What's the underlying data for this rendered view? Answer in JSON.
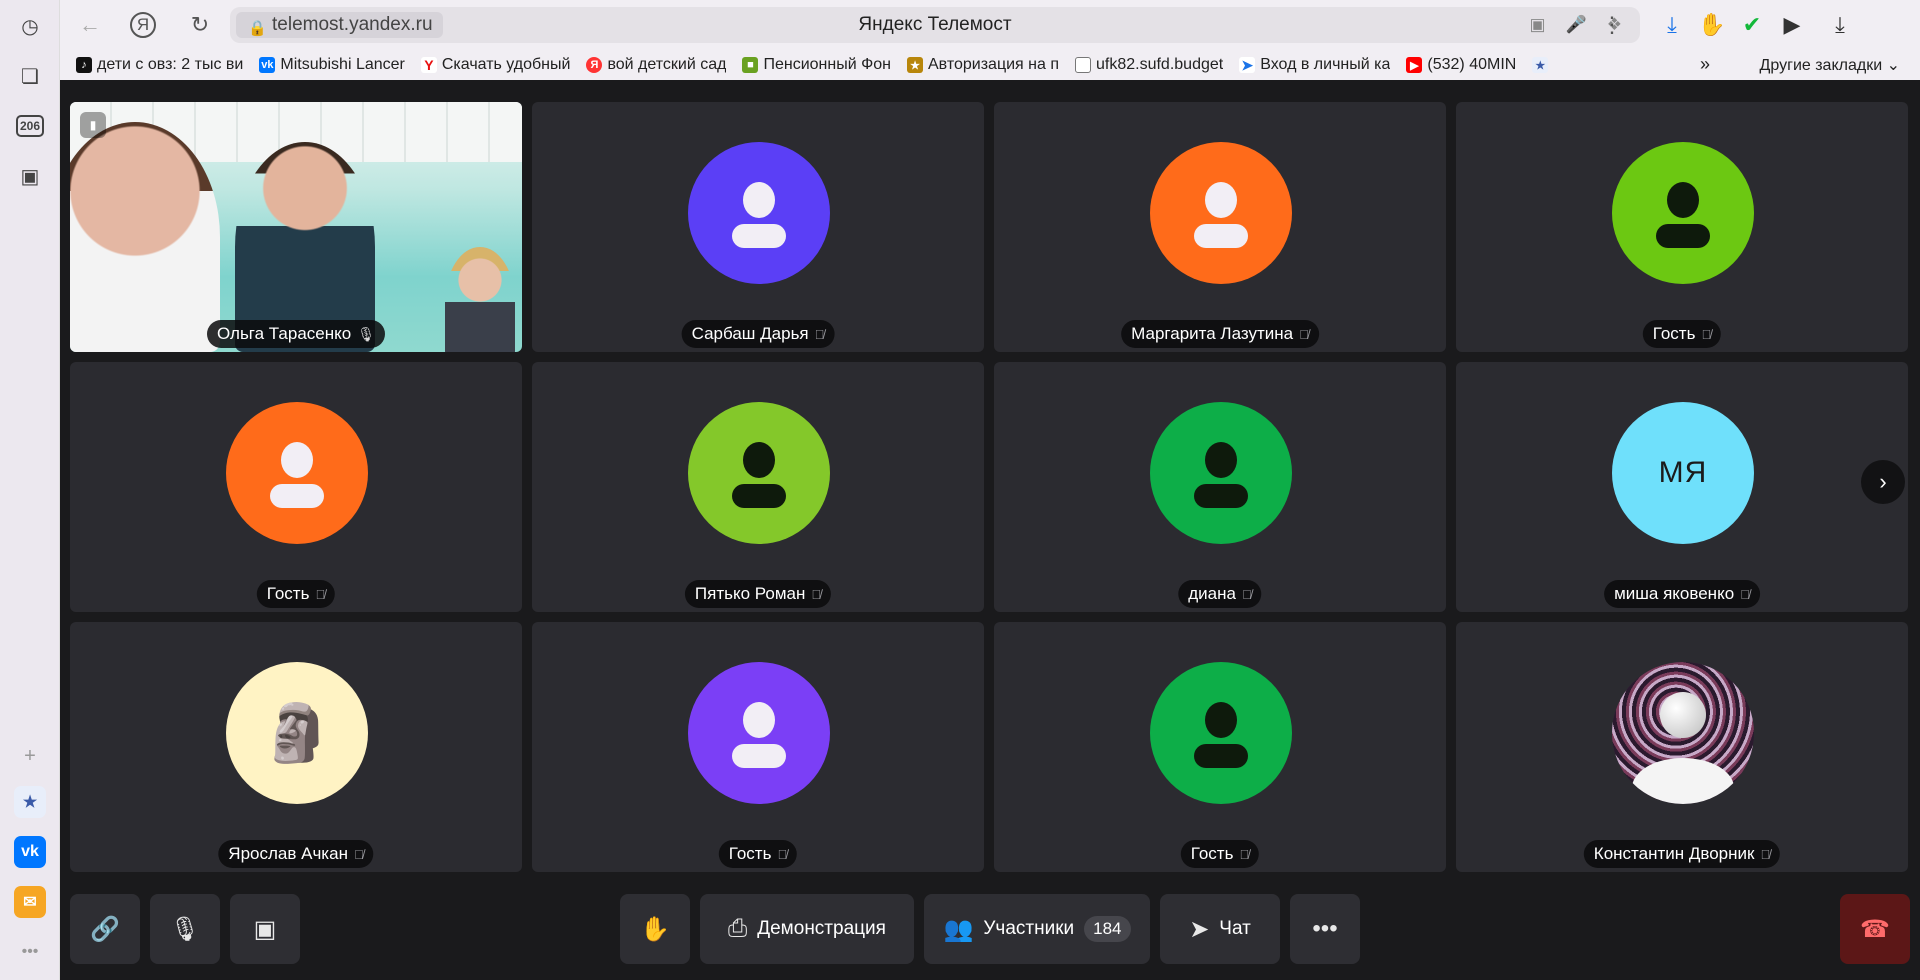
{
  "browser": {
    "url": "telemost.yandex.ru",
    "page_title": "Яндекс Телемост",
    "sidebar_badge": "206"
  },
  "bookmarks": [
    {
      "label": "дети с овз: 2 тыс ви",
      "icon": "tiktok-icon",
      "color": "#111111"
    },
    {
      "label": "Mitsubishi Lancer",
      "icon": "vk-icon",
      "color": "#0077ff"
    },
    {
      "label": "Скачать удобный",
      "icon": "hand-icon",
      "color": "#333333"
    },
    {
      "label": "вой детский сад",
      "icon": "yandex-y-icon",
      "color": "#ff2222"
    },
    {
      "label": "Пенсионный Фон",
      "icon": "yandex-icon",
      "color": "#ff3333"
    },
    {
      "label": "Авторизация на п",
      "icon": "pfr-icon",
      "color": "#6aa121"
    },
    {
      "label": "ufk82.sufd.budget",
      "icon": "emblem-icon",
      "color": "#b8860b"
    },
    {
      "label": "Вход в личный ка",
      "icon": "document-icon",
      "color": "#777777"
    },
    {
      "label": "(532) 40MIN",
      "icon": "arrow-icon",
      "color": "#1a73e8"
    },
    {
      "label": "",
      "icon": "youtube-icon",
      "color": "#ff0000"
    }
  ],
  "bookmarks_more": "»",
  "bookmarks_other": "Другие закладки",
  "participants": [
    {
      "name": "Ольга Тарасенко",
      "type": "video",
      "mic": "on"
    },
    {
      "name": "Сарбаш Дарья",
      "type": "avatar",
      "color": "#5b3ff6",
      "figure": "light",
      "mic": "off"
    },
    {
      "name": "Маргарита Лазутина",
      "type": "avatar",
      "color": "#ff6b1a",
      "figure": "light",
      "mic": "off"
    },
    {
      "name": "Гость",
      "type": "avatar",
      "color": "#6cc812",
      "figure": "dark",
      "mic": "off"
    },
    {
      "name": "Гость",
      "type": "avatar",
      "color": "#ff6b1a",
      "figure": "light",
      "mic": "off"
    },
    {
      "name": "Пятько Роман",
      "type": "avatar",
      "color": "#84c82a",
      "figure": "dark",
      "mic": "off"
    },
    {
      "name": "диана",
      "type": "avatar",
      "color": "#0dae48",
      "figure": "dark",
      "mic": "off"
    },
    {
      "name": "миша яковенко",
      "type": "initials",
      "color": "#6fe0fb",
      "initials": "МЯ",
      "mic": "off"
    },
    {
      "name": "Ярослав Ачкан",
      "type": "moai",
      "color": "#fff3c4",
      "mic": "off"
    },
    {
      "name": "Гость",
      "type": "avatar",
      "color": "#7b3ff6",
      "figure": "light",
      "mic": "off"
    },
    {
      "name": "Гость",
      "type": "avatar",
      "color": "#0dae48",
      "figure": "dark",
      "mic": "off"
    },
    {
      "name": "Константин Дворник",
      "type": "art",
      "mic": "off"
    }
  ],
  "controls": {
    "demo_label": "Демонстрация",
    "participants_label": "Участники",
    "participants_count": "184",
    "chat_label": "Чат"
  }
}
